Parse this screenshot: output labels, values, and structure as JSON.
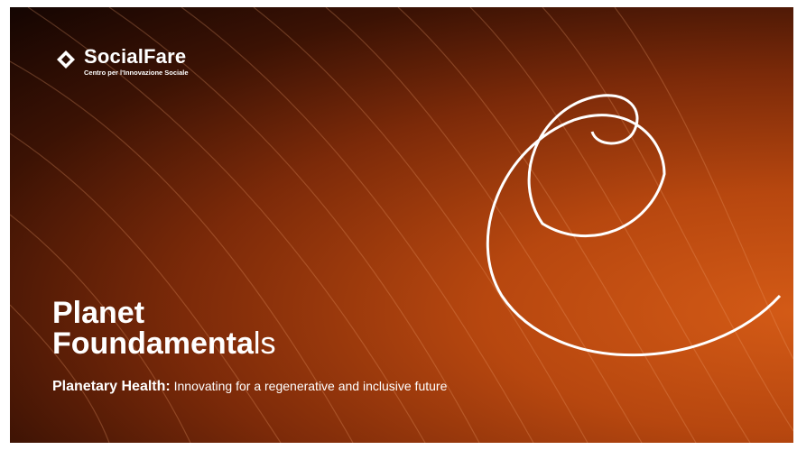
{
  "brand": {
    "name": "SocialFare",
    "tagline": "Centro per l'Innovazione Sociale",
    "logo_icon": "socialfare-logo-icon"
  },
  "title": {
    "line1": "Planet",
    "line2_bold": "Foundamenta",
    "line2_light": "ls"
  },
  "subtitle": {
    "bold": "Planetary Health:",
    "rest": " Innovating for a regenerative and inclusive future"
  },
  "colors": {
    "background_dark": "#140502",
    "background_orange": "#d35a16",
    "text": "#ffffff"
  }
}
